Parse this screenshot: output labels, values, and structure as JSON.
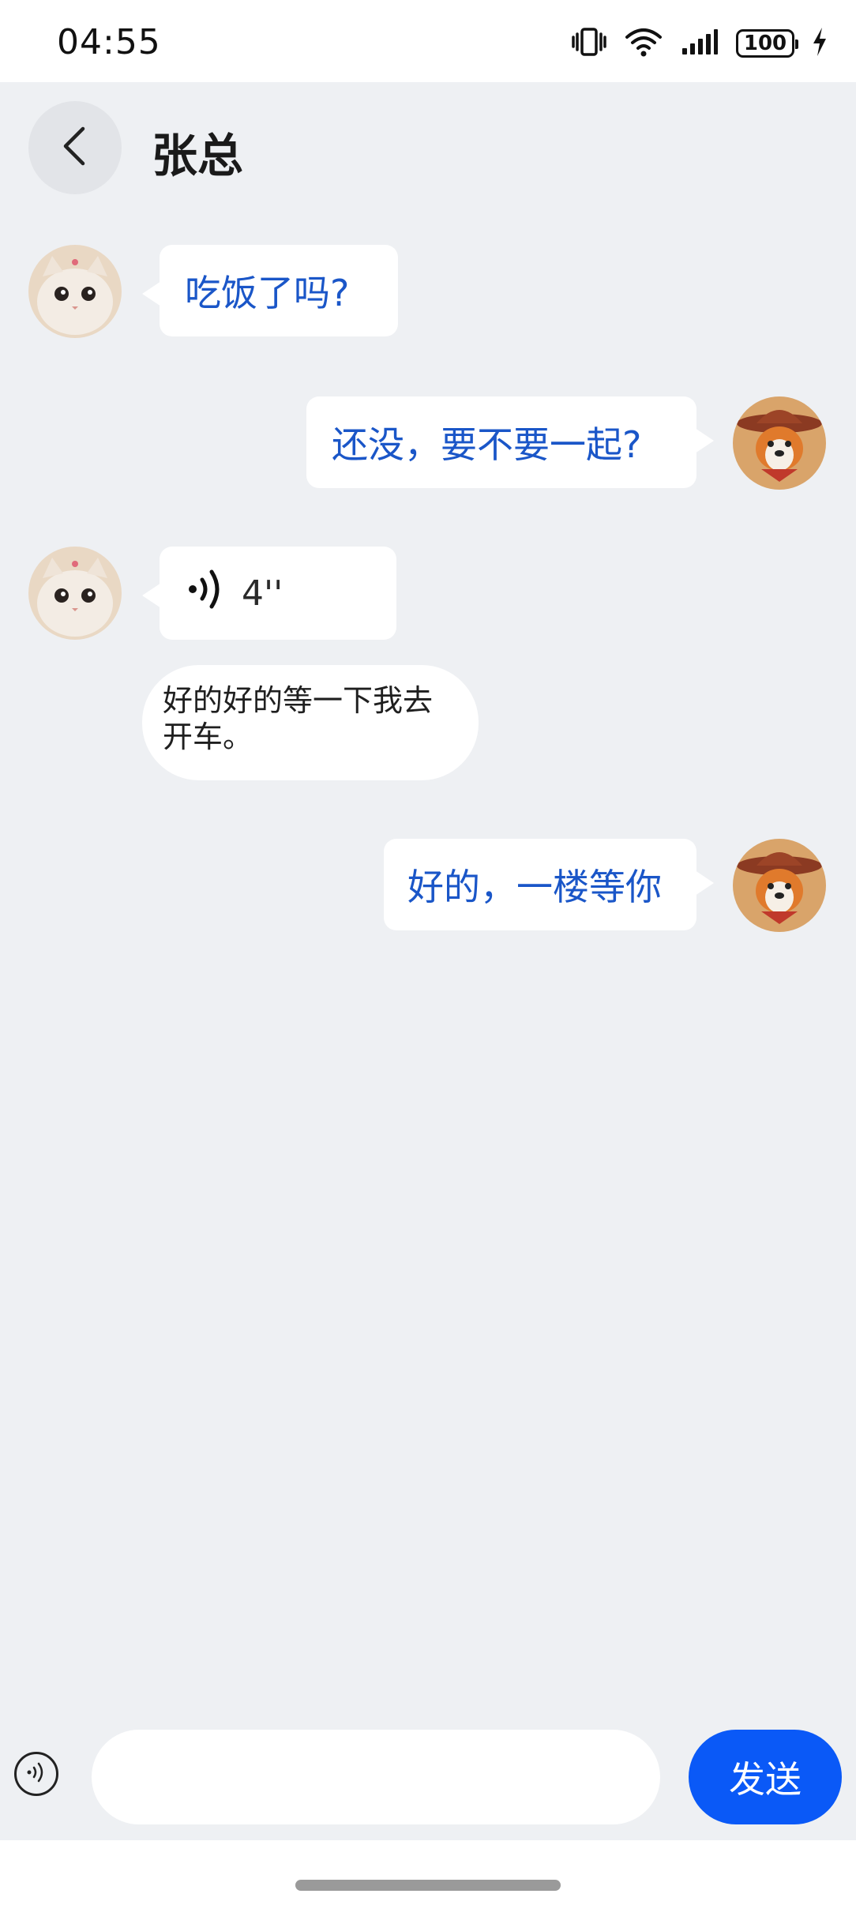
{
  "status_bar": {
    "time": "04:55",
    "battery": "100"
  },
  "header": {
    "title": "张总"
  },
  "messages": [
    {
      "text": "吃饭了吗?"
    },
    {
      "text": "还没，要不要一起?"
    },
    {
      "duration": "4''",
      "transcript": "好的好的等一下我去开车。"
    },
    {
      "text": "好的，一楼等你"
    }
  ],
  "input": {
    "placeholder": ""
  },
  "send_button": {
    "label": "发送"
  },
  "colors": {
    "accent": "#0a59f7",
    "bubble_text": "#1a56c8",
    "background": "#eef0f3"
  }
}
